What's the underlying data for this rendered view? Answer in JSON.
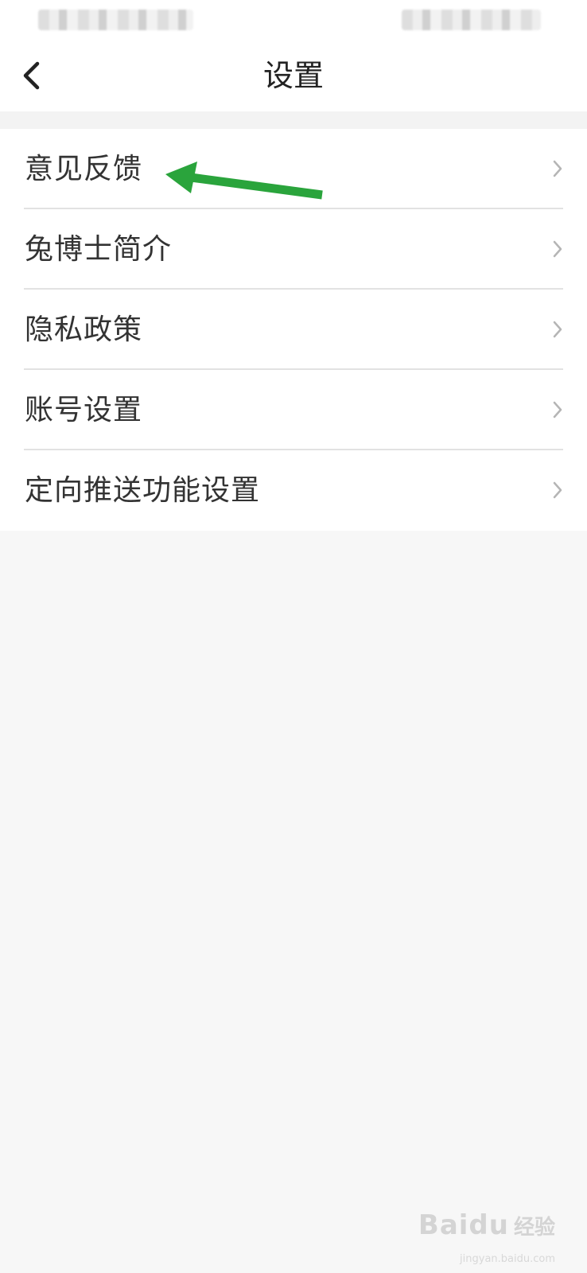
{
  "header": {
    "title": "设置",
    "back_icon": "chevron-left-icon"
  },
  "settings": {
    "items": [
      {
        "label": "意见反馈"
      },
      {
        "label": "兔博士简介"
      },
      {
        "label": "隐私政策"
      },
      {
        "label": "账号设置"
      },
      {
        "label": "定向推送功能设置"
      }
    ],
    "item_icon": "chevron-right-icon"
  },
  "annotation": {
    "arrow_color": "#2aa43c"
  },
  "watermark": {
    "brand": "Baidu",
    "product": "经验",
    "url": "jingyan.baidu.com"
  },
  "colors": {
    "background": "#f7f7f7",
    "surface": "#ffffff",
    "text": "#333333",
    "divider": "#e2e2e2"
  }
}
